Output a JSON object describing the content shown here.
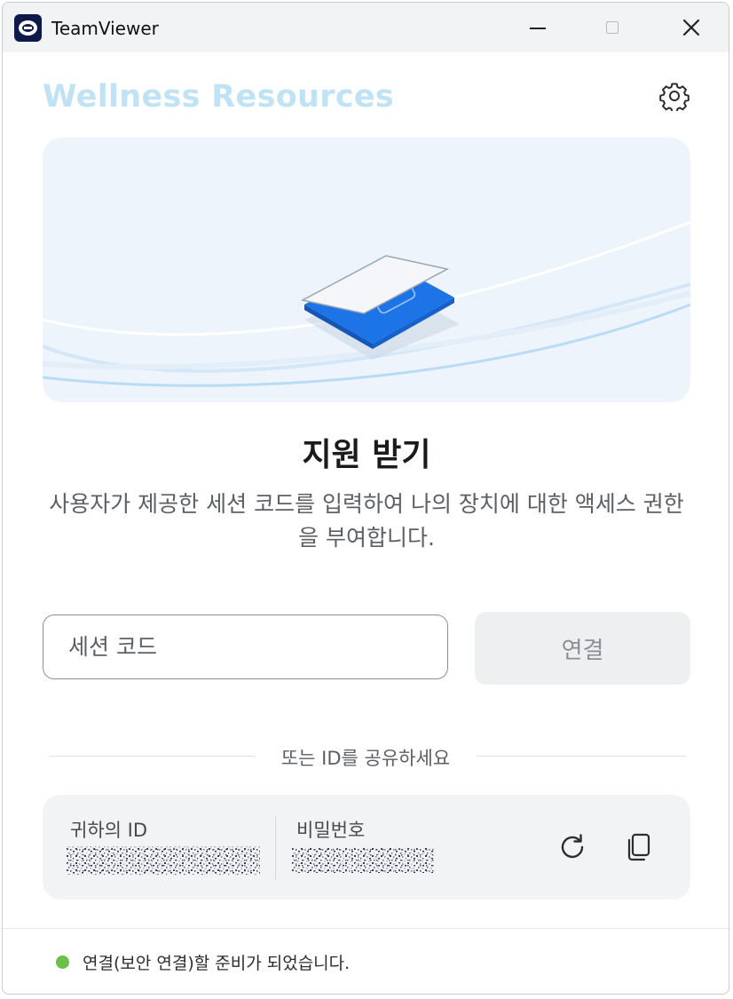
{
  "window": {
    "app_title": "TeamViewer",
    "controls": [
      "minimize",
      "maximize",
      "close"
    ]
  },
  "header": {
    "brand": "Wellness Resources",
    "settings_icon": "gear-icon"
  },
  "main": {
    "heading": "지원 받기",
    "description": "사용자가 제공한 세션 코드를 입력하여 나의 장치에 대한 액세스 권한을 부여합니다.",
    "session_input_placeholder": "세션 코드",
    "connect_label": "연결",
    "divider_text": "또는 ID를 공유하세요",
    "your_id_label": "귀하의 ID",
    "password_label": "비밀번호",
    "refresh_icon": "refresh-icon",
    "copy_icon": "copy-icon"
  },
  "status": {
    "text": "연결(보안 연결)할 준비가 되었습니다.",
    "state_color": "#6cc04a"
  },
  "colors": {
    "accent": "#1a73e8",
    "brand": "#bfe3f4",
    "hero_bg": "#eef4fb"
  }
}
